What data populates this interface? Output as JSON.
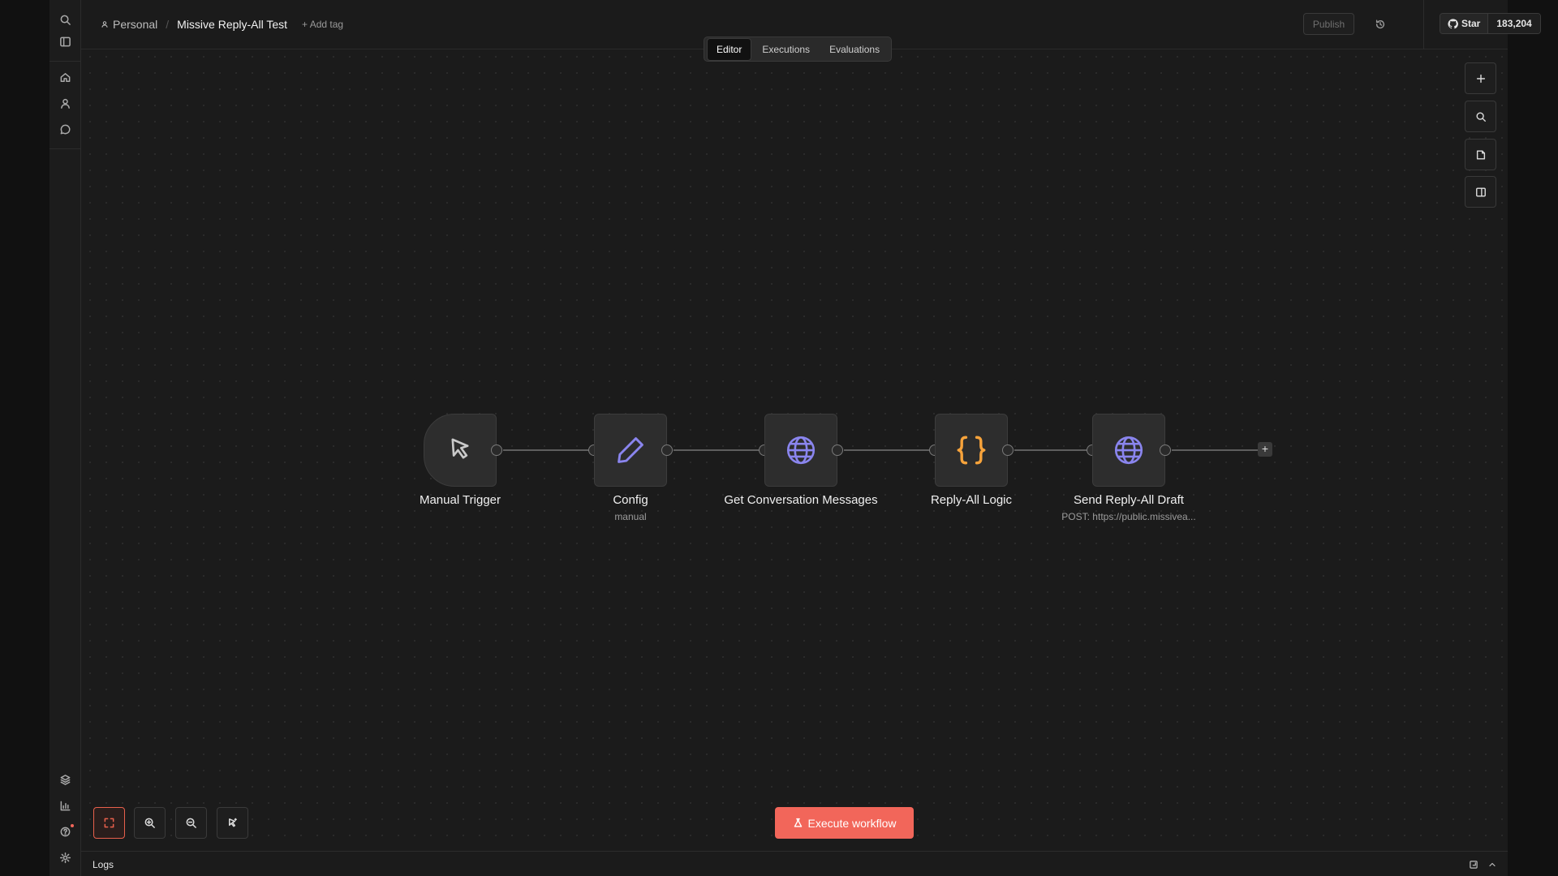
{
  "app": {
    "breadcrumb": {
      "project": "Personal",
      "workflow": "Missive Reply-All Test",
      "add_tag": "+ Add tag"
    },
    "publish_label": "Publish",
    "github": {
      "star_label": "Star",
      "star_count": "183,204"
    },
    "tabs": [
      {
        "label": "Editor",
        "active": true
      },
      {
        "label": "Executions",
        "active": false
      },
      {
        "label": "Evaluations",
        "active": false
      }
    ]
  },
  "sidebar": {
    "top_icons": [
      "search-icon",
      "panel-toggle-icon"
    ],
    "nav_icons": [
      "home-icon",
      "user-icon",
      "chat-icon"
    ],
    "bottom_icons": [
      "templates-icon",
      "insights-icon",
      "help-icon",
      "settings-icon"
    ]
  },
  "canvas": {
    "nodes": [
      {
        "name": "Manual Trigger",
        "subtitle": "",
        "icon": "cursor-icon",
        "icon_color": "#c9c9c9"
      },
      {
        "name": "Config",
        "subtitle": "manual",
        "icon": "pencil-icon",
        "icon_color": "#8a85ee"
      },
      {
        "name": "Get Conversation Messages",
        "subtitle": "",
        "icon": "globe-icon",
        "icon_color": "#8a85ee"
      },
      {
        "name": "Reply-All Logic",
        "subtitle": "",
        "icon": "code-braces-icon",
        "icon_color": "#f7a33b"
      },
      {
        "name": "Send Reply-All Draft",
        "subtitle": "POST: https://public.missivea...",
        "icon": "globe-icon",
        "icon_color": "#8a85ee"
      }
    ],
    "execute_label": "Execute workflow",
    "accent": "#f2665a"
  },
  "right_toolbar": [
    "plus-icon",
    "search-icon",
    "sticky-note-icon",
    "panel-icon"
  ],
  "bottom_toolbar": [
    "fit-view-icon",
    "zoom-in-icon",
    "zoom-out-icon",
    "tidy-up-icon"
  ],
  "logs": {
    "label": "Logs"
  }
}
